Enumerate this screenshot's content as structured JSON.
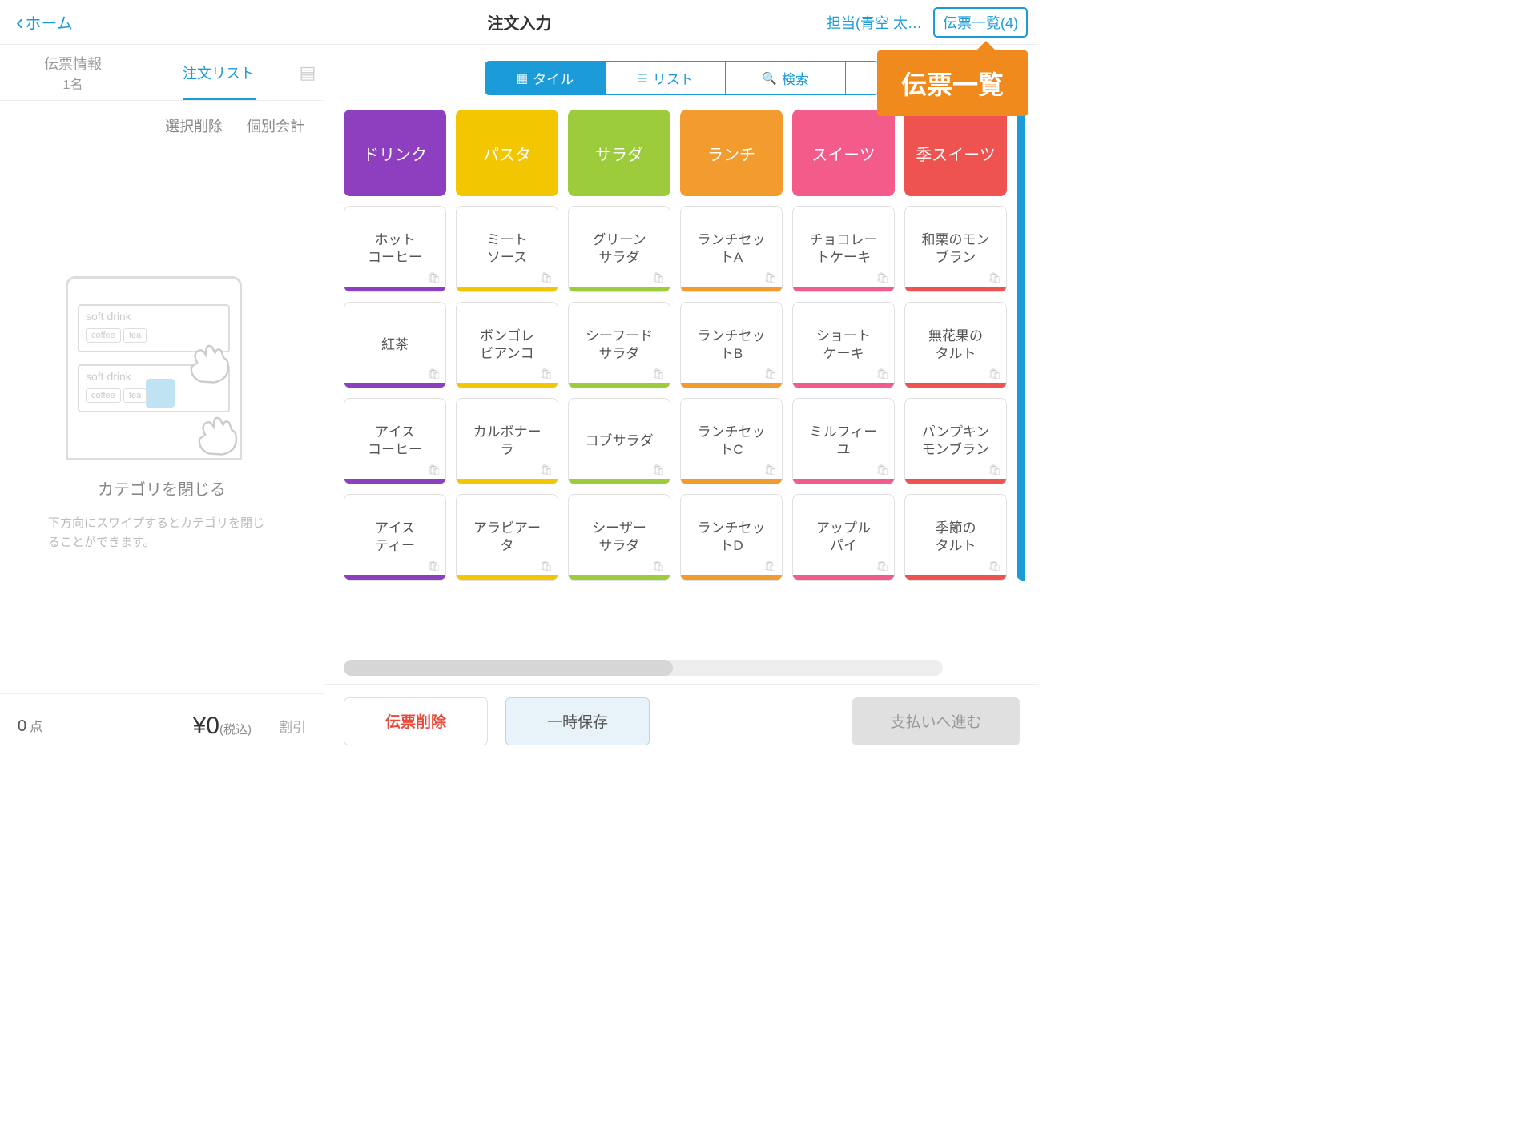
{
  "header": {
    "back": "ホーム",
    "title": "注文入力",
    "staff": "担当(青空 太…",
    "slip_list": "伝票一覧(4)"
  },
  "callout": "伝票一覧",
  "left": {
    "tab_info": "伝票情報",
    "tab_info_sub": "1名",
    "tab_list": "注文リスト",
    "action_delete": "選択削除",
    "action_split": "個別会計",
    "empty_title": "カテゴリを閉じる",
    "empty_desc": "下方向にスワイプするとカテゴリを閉じることができます。",
    "count_value": "0",
    "count_unit": "点",
    "total": "¥0",
    "tax_label": "(税込)",
    "discount": "割引"
  },
  "viewbar": {
    "tile": "タイル",
    "list": "リスト",
    "search": "検索"
  },
  "colors": {
    "purple": "#8e3fbf",
    "yellow": "#f2c600",
    "green": "#9ccc3c",
    "orange": "#f29b2e",
    "pink": "#f25b8a",
    "red": "#ef5350",
    "blue": "#1b9cd8"
  },
  "categories": [
    {
      "name": "ドリンク",
      "color": "purple"
    },
    {
      "name": "パスタ",
      "color": "yellow"
    },
    {
      "name": "サラダ",
      "color": "green"
    },
    {
      "name": "ランチ",
      "color": "orange"
    },
    {
      "name": "スイーツ",
      "color": "pink"
    },
    {
      "name": "季スイーツ",
      "color": "red"
    }
  ],
  "products": [
    [
      "ホット\nコーヒー",
      "紅茶",
      "アイス\nコーヒー",
      "アイス\nティー"
    ],
    [
      "ミート\nソース",
      "ボンゴレ\nビアンコ",
      "カルボナー\nラ",
      "アラビアー\nタ"
    ],
    [
      "グリーン\nサラダ",
      "シーフード\nサラダ",
      "コブサラダ",
      "シーザー\nサラダ"
    ],
    [
      "ランチセッ\nトA",
      "ランチセッ\nトB",
      "ランチセッ\nトC",
      "ランチセッ\nトD"
    ],
    [
      "チョコレー\nトケーキ",
      "ショート\nケーキ",
      "ミルフィー\nユ",
      "アップル\nパイ"
    ],
    [
      "和栗のモン\nブラン",
      "無花果の\nタルト",
      "パンプキン\nモンブラン",
      "季節の\nタルト"
    ]
  ],
  "footer": {
    "delete": "伝票削除",
    "save": "一時保存",
    "pay": "支払いへ進む"
  }
}
